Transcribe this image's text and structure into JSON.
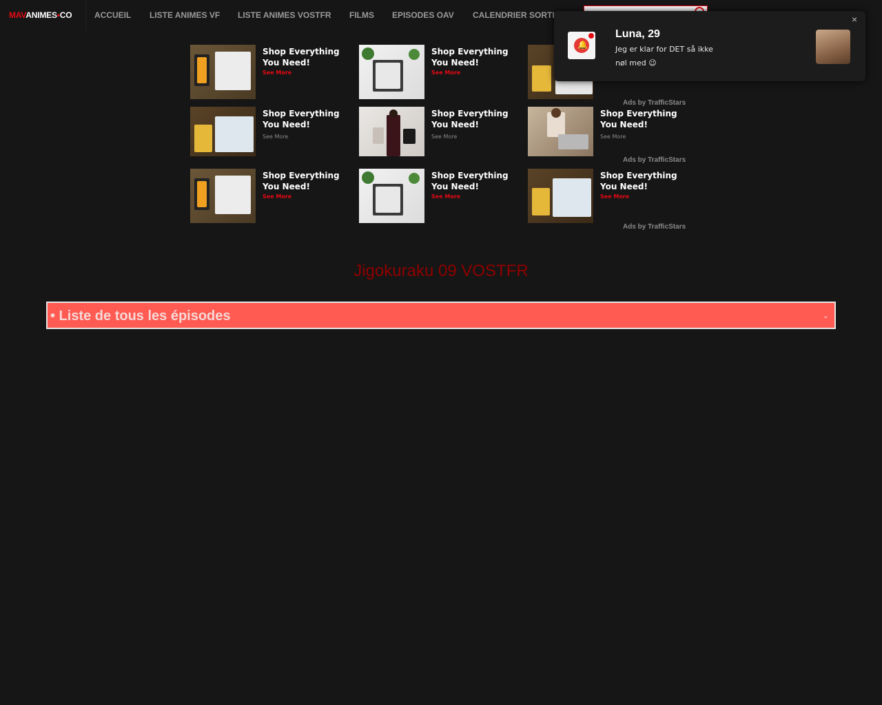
{
  "nav": {
    "logo": {
      "part1": "MAV",
      "part2": "ANIMES",
      "dot": "•",
      "part3": "CO"
    },
    "items": [
      "ACCUEIL",
      "LISTE ANIMES VF",
      "LISTE ANIMES VOSTFR",
      "FILMS",
      "EPISODES OAV",
      "CALENDRIER SORTIES"
    ]
  },
  "ads": {
    "title": "Shop Everything You Need!",
    "cta": "See More",
    "attribution": "Ads by TrafficStars"
  },
  "episode_title": "Jigokuraku 09 VOSTFR",
  "episodes_dropdown": {
    "label": "• Liste de tous les épisodes",
    "chevron": "⌄"
  },
  "notification": {
    "name": "Luna, 29",
    "message": "Jeg er klar for DET så ikke nøl med 😉",
    "close": "×",
    "badge_icon": "bell-icon"
  },
  "colors": {
    "accent": "#e50914",
    "bar": "#ff5b52",
    "title": "#8f0000",
    "background": "#161616"
  }
}
